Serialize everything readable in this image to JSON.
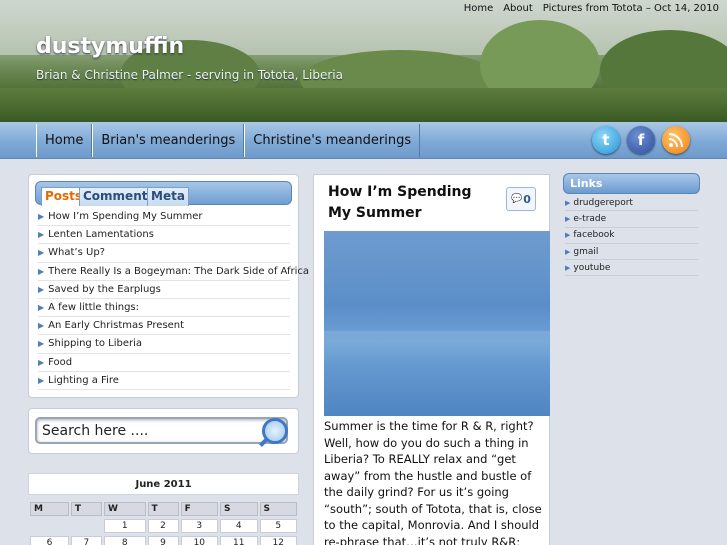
{
  "site": {
    "title": "dustymuffin",
    "description": "Brian & Christine Palmer - serving in Totota, Liberia"
  },
  "topnav": [
    "Home",
    "About",
    "Pictures from Totota – Oct 14, 2010"
  ],
  "menu": [
    "Home",
    "Brian's meanderings",
    "Christine's meanderings"
  ],
  "social": {
    "twitter": "t",
    "facebook": "f"
  },
  "sidebar_tabs": [
    "Posts",
    "Comments",
    "Meta"
  ],
  "posts": [
    "How I’m Spending My Summer",
    "Lenten Lamentations",
    "What’s Up?",
    "There Really Is a Bogeyman: The Dark Side of Africa",
    "Saved by the Earplugs",
    "A few little things:",
    "An Early Christmas Present",
    "Shipping to Liberia",
    "Food",
    "Lighting a Fire"
  ],
  "search": {
    "placeholder": "Search here ...."
  },
  "calendar": {
    "month": "June 2011",
    "days": [
      "M",
      "T",
      "W",
      "T",
      "F",
      "S",
      "S"
    ],
    "week1": [
      "1",
      "2",
      "3",
      "4",
      "5"
    ],
    "week2": [
      "6",
      "7",
      "8",
      "9",
      "10",
      "11",
      "12"
    ]
  },
  "post": {
    "title": "How I’m Spending My Summer",
    "comments": "0",
    "body": "Summer is the time for R & R, right? Well, how do you do such a thing in Liberia? To REALLY relax and “get away” from the hustle and bustle of the daily grind? For us it’s going “south”; south of Totota, that is, close to the capital, Monrovia. And I should re-phrase that…it’s not truly R&R; we’ll be busy,"
  },
  "links": {
    "title": "Links",
    "items": [
      "drudgereport",
      "e-trade",
      "facebook",
      "gmail",
      "youtube"
    ]
  }
}
